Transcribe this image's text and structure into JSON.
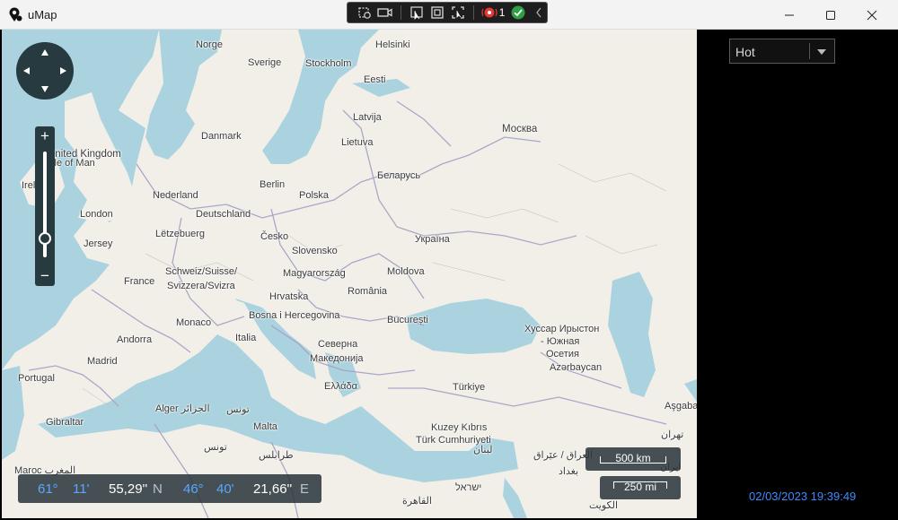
{
  "window": {
    "title": "uMap",
    "icon": "umap-logo-icon",
    "controls": [
      "minimize-icon",
      "maximize-icon",
      "close-icon"
    ]
  },
  "capture_toolbar": {
    "icons": [
      "screenshot-region-icon",
      "video-camera-icon",
      "select-pointer-icon",
      "window-capture-icon",
      "region-select-icon",
      "record-icon",
      "checkmark-icon",
      "chevron-left-icon"
    ],
    "record_count": "1"
  },
  "map": {
    "labels": {
      "norge": "Norge",
      "sverige": "Sverige",
      "helsinki": "Helsinki",
      "stockholm": "Stockholm",
      "eesti": "Eesti",
      "latvija": "Latvija",
      "danmark": "Danmark",
      "lietuva": "Lietuva",
      "moskva": "Москва",
      "uk": "United Kingdom",
      "isle_of_man": "Isle of Man",
      "ireland": "Ireland",
      "nederland": "Nederland",
      "berlin": "Berlin",
      "polska": "Polska",
      "belarus": "Беларусь",
      "london": "London",
      "deutschland": "Deutschland",
      "letzebuerg": "Lëtzebuerg",
      "cesko": "Česko",
      "ukraina": "Україна",
      "jersey": "Jersey",
      "slovensko": "Slovensko",
      "schweiz": "Schweiz/Suisse/",
      "svizzera": "Svizzera/Svizra",
      "magyarorszag": "Magyarország",
      "moldova": "Moldova",
      "france": "France",
      "hrvatska": "Hrvatska",
      "romania": "România",
      "monaco": "Monaco",
      "bosna": "Bosna i Hercegovina",
      "bucuresti": "București",
      "andorra": "Andorra",
      "italia": "Italia",
      "hussar": "Хуссар Ирыстон",
      "yuzhnaya": "- Южная",
      "osetiya": "Осетия",
      "severna": "Северна",
      "makedonija": "Македонија",
      "madrid": "Madrid",
      "azerbaycan": "Azərbaycan",
      "portugal": "Portugal",
      "ellada": "Ελλάδα",
      "turkiye": "Türkiye",
      "algerie": "Alger الجزائر",
      "tunis": "تونس",
      "malta": "Malta",
      "gibraltar": "Gibraltar",
      "tunes": "تونس",
      "kuzey": "Kuzey Kıbrıs",
      "turk": "Türk Cumhuriyeti",
      "asgabat": "Aşgabat",
      "tehran": "تهران",
      "trablus": "طرابلس",
      "lubnan": "لبنان",
      "iraq": "العراق / عێراق",
      "iran": "ایران",
      "maroc": "Maroc المغرب",
      "israel": "ישראל",
      "cairo": "القاهرة",
      "kuwait": "الكويت",
      "baghdad": "بغداد"
    },
    "pan_control": {
      "icons": [
        "pan-up-icon",
        "pan-left-icon",
        "pan-right-icon",
        "pan-down-icon"
      ]
    },
    "zoom": {
      "in_label": "+",
      "out_label": "−",
      "level_fraction": 0.82
    },
    "coords": {
      "lat_deg": "61°",
      "lat_min": "11'",
      "lat_sec": "55,29''",
      "lat_hemi": "N",
      "lon_deg": "46°",
      "lon_min": "40'",
      "lon_sec": "21,66''",
      "lon_hemi": "E"
    },
    "scale": {
      "km": "500 km",
      "mi": "250 mi"
    },
    "colors": {
      "water": "#aad3df",
      "land": "#f2efe9",
      "border": "#9e9ab8",
      "panel": "#263a40",
      "accent": "#5aa7ff"
    }
  },
  "panel": {
    "layer_select": {
      "value": "Hot"
    },
    "timestamp": "02/03/2023 19:39:49"
  }
}
